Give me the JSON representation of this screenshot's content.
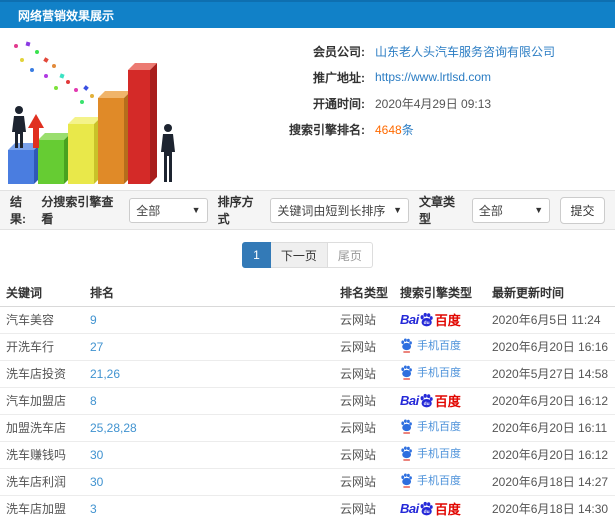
{
  "header": {
    "title": "网络营销效果展示"
  },
  "info": {
    "rows": [
      {
        "label": "会员公司:",
        "value": "山东老人头汽车服务咨询有限公司"
      },
      {
        "label": "推广地址:",
        "value": "https://www.lrtlsd.com"
      },
      {
        "label": "开通时间:",
        "value": "2020年4月29日 09:13"
      },
      {
        "label": "搜索引擎排名:",
        "value": "4648",
        "suffix": "条"
      }
    ]
  },
  "illustration": {
    "alt": "growth-bar-chart-clipart"
  },
  "filters": {
    "result_label": "结果:",
    "engine_filter_label": "分搜索引擎查看",
    "engine_filter_value": "全部",
    "sort_label": "排序方式",
    "sort_value": "关键词由短到长排序",
    "article_type_label": "文章类型",
    "article_type_value": "全部",
    "submit_label": "提交"
  },
  "pagination": {
    "current": "1",
    "next_label": "下一页",
    "last_label": "尾页"
  },
  "table": {
    "headers": [
      "关键词",
      "排名",
      "排名类型",
      "搜索引擎类型",
      "最新更新时间"
    ],
    "engine_labels": {
      "baidu_bai": "Bai",
      "baidu_du": "du",
      "baidu_cn": "百度",
      "mobile": "手机百度"
    },
    "rows": [
      {
        "keyword": "汽车美容",
        "rank": "9",
        "rank_type": "云网站",
        "engine": "baidu",
        "updated": "2020年6月5日 11:24"
      },
      {
        "keyword": "开洗车行",
        "rank": "27",
        "rank_type": "云网站",
        "engine": "mobile-baidu",
        "updated": "2020年6月20日 16:16"
      },
      {
        "keyword": "洗车店投资",
        "rank": "21,26",
        "rank_type": "云网站",
        "engine": "mobile-baidu",
        "updated": "2020年5月27日 14:58"
      },
      {
        "keyword": "汽车加盟店",
        "rank": "8",
        "rank_type": "云网站",
        "engine": "baidu",
        "updated": "2020年6月20日 16:12"
      },
      {
        "keyword": "加盟洗车店",
        "rank": "25,28,28",
        "rank_type": "云网站",
        "engine": "mobile-baidu",
        "updated": "2020年6月20日 16:11"
      },
      {
        "keyword": "洗车赚钱吗",
        "rank": "30",
        "rank_type": "云网站",
        "engine": "mobile-baidu",
        "updated": "2020年6月20日 16:12"
      },
      {
        "keyword": "洗车店利润",
        "rank": "30",
        "rank_type": "云网站",
        "engine": "mobile-baidu",
        "updated": "2020年6月18日 14:27"
      },
      {
        "keyword": "洗车店加盟",
        "rank": "3",
        "rank_type": "云网站",
        "engine": "baidu",
        "updated": "2020年6月18日 14:30"
      }
    ]
  },
  "colors": {
    "header_bg": "#1181c8",
    "link_blue": "#2a7cc3",
    "highlight_orange": "#ff6a00",
    "rank_blue": "#4193d0",
    "baidu_blue": "#2529d8",
    "baidu_red": "#e10601",
    "active_page_blue": "#337ab7"
  }
}
